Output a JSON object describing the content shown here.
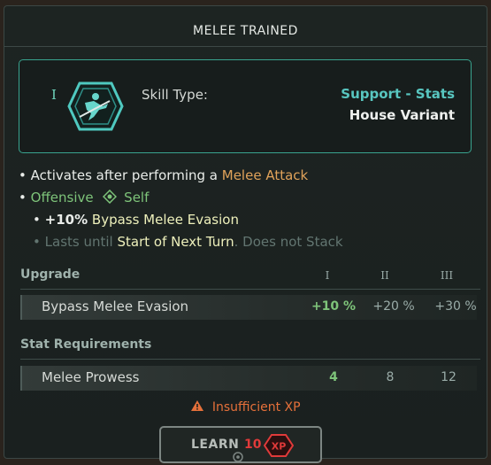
{
  "title": "MELEE TRAINED",
  "skill": {
    "tier_mark": "I",
    "type_label": "Skill Type:",
    "type_value": "Support - Stats",
    "variant": "House Variant",
    "icon": "melee-skill-emblem-icon"
  },
  "effects": {
    "activate_prefix": "• Activates after performing a",
    "activate_trigger": "Melee Attack",
    "offensive": "Offensive",
    "target_icon": "self-target-icon",
    "self": "Self",
    "bonus_value": "+10%",
    "bonus_text": "Bypass Melee Evasion",
    "lasts_until": "Lasts until",
    "duration": "Start of Next Turn",
    "stacking": ". Does not Stack"
  },
  "upgrade": {
    "header": "Upgrade",
    "tiers": [
      "I",
      "II",
      "III"
    ],
    "stat": "Bypass Melee Evasion",
    "values": [
      "+10 %",
      "+20 %",
      "+30 %"
    ]
  },
  "requirements": {
    "header": "Stat Requirements",
    "stat": "Melee Prowess",
    "values": [
      "4",
      "8",
      "12"
    ]
  },
  "warning": {
    "icon": "warning-icon",
    "text": "Insufficient XP"
  },
  "learn": {
    "label": "LEARN",
    "cost": "10",
    "currency": "XP"
  },
  "colors": {
    "accent_teal": "#39a48f",
    "trigger_orange": "#e0a25a",
    "offensive_green": "#7ec47a",
    "warning_orange": "#e5703a",
    "cost_red": "#e03a3a"
  }
}
